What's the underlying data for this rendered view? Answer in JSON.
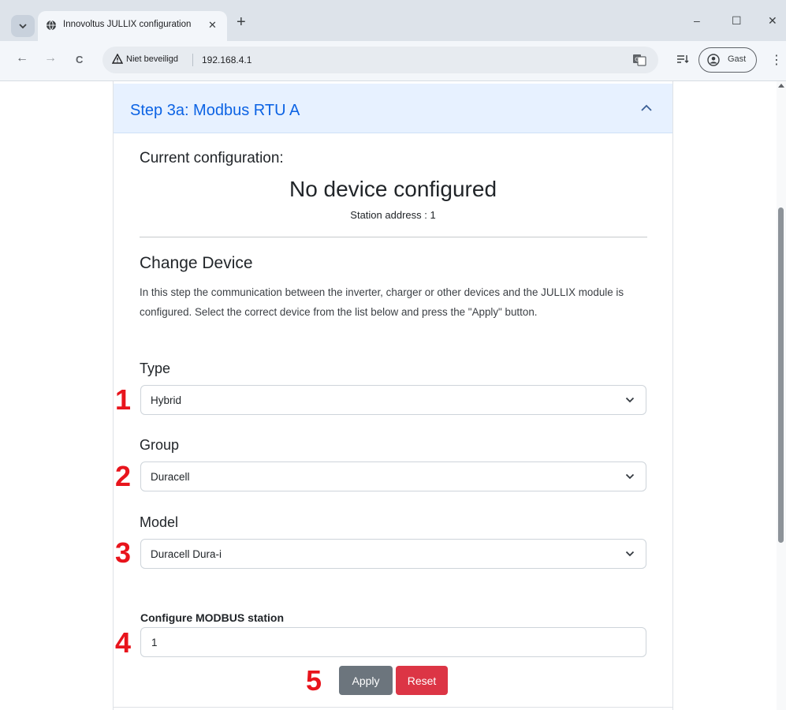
{
  "browser": {
    "tab_title": "Innovoltus JULLIX configuration",
    "tab_close": "✕",
    "new_tab": "+",
    "security_label": "Niet beveiligd",
    "url": "192.168.4.1",
    "profile_label": "Gast",
    "window_controls": {
      "minimize": "–",
      "maximize": "☐",
      "close": "✕"
    },
    "nav": {
      "back": "←",
      "forward": "→",
      "reload": "C"
    },
    "kebab": "⋮"
  },
  "accordion": {
    "title": "Step 3a: Modbus RTU A"
  },
  "current": {
    "heading": "Current configuration:",
    "device": "No device configured",
    "station_address": "Station address : 1"
  },
  "change": {
    "heading": "Change Device",
    "description": "In this step the communication between the inverter, charger or other devices and the JULLIX module is configured. Select the correct device from the list below and press the \"Apply\" button."
  },
  "fields": {
    "type": {
      "label": "Type",
      "value": "Hybrid"
    },
    "group": {
      "label": "Group",
      "value": "Duracell"
    },
    "model": {
      "label": "Model",
      "value": "Duracell Dura-i"
    },
    "modbus": {
      "label": "Configure MODBUS station",
      "value": "1"
    }
  },
  "buttons": {
    "apply": "Apply",
    "reset": "Reset"
  },
  "markers": [
    "1",
    "2",
    "3",
    "4",
    "5"
  ],
  "colors": {
    "accent": "#0c63e4",
    "accordion_bg": "#e7f1ff",
    "marker": "#e8141c",
    "apply": "#6c757d",
    "reset": "#dc3545"
  }
}
